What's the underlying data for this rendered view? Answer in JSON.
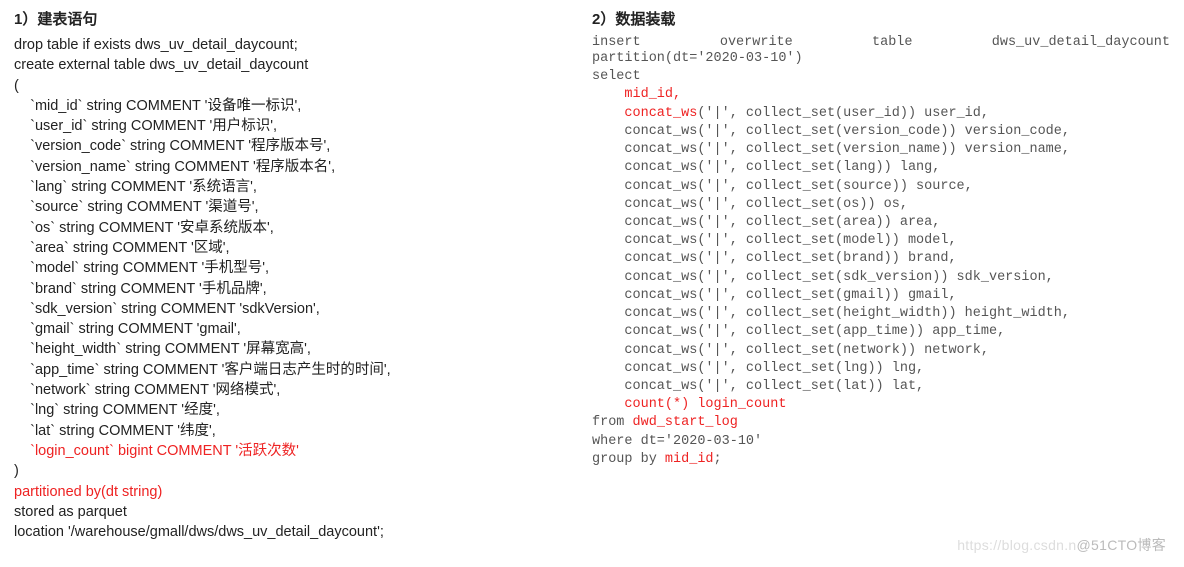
{
  "left": {
    "heading": "1）建表语句",
    "l1": "drop table if exists dws_uv_detail_daycount;",
    "l2": "create external table dws_uv_detail_daycount",
    "l3": "(",
    "l4": "    `mid_id` string COMMENT '设备唯一标识',",
    "l5": "    `user_id` string COMMENT '用户标识',",
    "l6": "    `version_code` string COMMENT '程序版本号',",
    "l7": "    `version_name` string COMMENT '程序版本名',",
    "l8": "    `lang` string COMMENT '系统语言',",
    "l9": "    `source` string COMMENT '渠道号',",
    "l10": "    `os` string COMMENT '安卓系统版本',",
    "l11": "    `area` string COMMENT '区域',",
    "l12": "    `model` string COMMENT '手机型号',",
    "l13": "    `brand` string COMMENT '手机品牌',",
    "l14": "    `sdk_version` string COMMENT 'sdkVersion',",
    "l15": "    `gmail` string COMMENT 'gmail',",
    "l16": "    `height_width` string COMMENT '屏幕宽高',",
    "l17": "    `app_time` string COMMENT '客户端日志产生时的时间',",
    "l18": "    `network` string COMMENT '网络模式',",
    "l19": "    `lng` string COMMENT '经度',",
    "l20": "    `lat` string COMMENT '纬度',",
    "l21": "    `login_count` bigint COMMENT '活跃次数'",
    "l22": ")",
    "l23": "partitioned by(dt string)",
    "l24": "stored as parquet",
    "l25": "location '/warehouse/gmall/dws/dws_uv_detail_daycount';"
  },
  "right": {
    "heading": "2）数据装载",
    "j1a": "insert",
    "j1b": "overwrite",
    "j1c": "table",
    "j1d": "dws_uv_detail_daycount",
    "r2": "partition(dt='2020-03-10')",
    "r3": "select",
    "r4a": "    ",
    "r4b": "mid_id,",
    "r5a": "    ",
    "r5b": "concat_ws",
    "r5c": "('|', collect_set(user_id)) user_id,",
    "r6": "    concat_ws('|', collect_set(version_code)) version_code,",
    "r7": "    concat_ws('|', collect_set(version_name)) version_name,",
    "r8": "    concat_ws('|', collect_set(lang)) lang,",
    "r9": "    concat_ws('|', collect_set(source)) source,",
    "r10": "    concat_ws('|', collect_set(os)) os,",
    "r11": "    concat_ws('|', collect_set(area)) area,",
    "r12": "    concat_ws('|', collect_set(model)) model,",
    "r13": "    concat_ws('|', collect_set(brand)) brand,",
    "r14": "    concat_ws('|', collect_set(sdk_version)) sdk_version,",
    "r15": "    concat_ws('|', collect_set(gmail)) gmail,",
    "r16": "    concat_ws('|', collect_set(height_width)) height_width,",
    "r17": "    concat_ws('|', collect_set(app_time)) app_time,",
    "r18": "    concat_ws('|', collect_set(network)) network,",
    "r19": "    concat_ws('|', collect_set(lng)) lng,",
    "r20": "    concat_ws('|', collect_set(lat)) lat,",
    "r21a": "    ",
    "r21b": "count(*) login_count",
    "r22a": "from ",
    "r22b": "dwd_start_log",
    "r23": "where dt='2020-03-10'",
    "r24a": "group by ",
    "r24b": "mid_id",
    "r24c": ";"
  },
  "watermark": {
    "faint": "https://blog.csdn.n",
    "main": "@51CTO博客"
  }
}
